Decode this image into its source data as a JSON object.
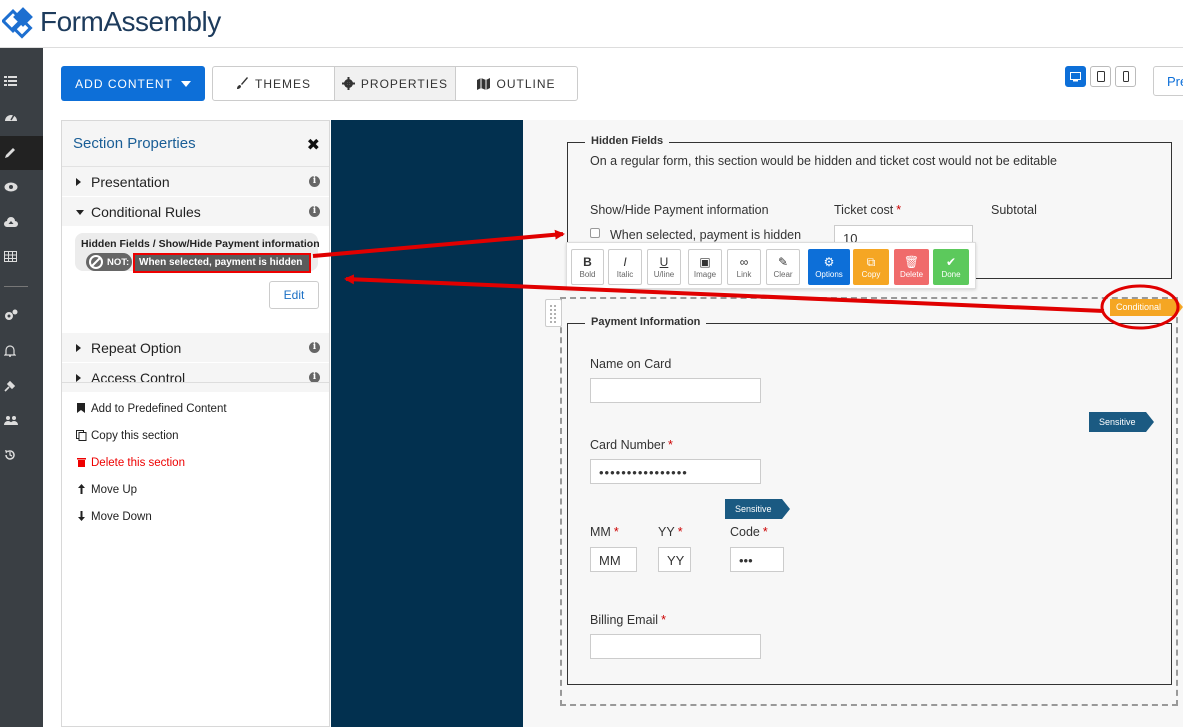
{
  "app": {
    "logo_text": "FormAssembly"
  },
  "toolbar": {
    "add_content_label": "ADD CONTENT",
    "tabs": [
      {
        "label": "THEMES",
        "icon": "brush-icon"
      },
      {
        "label": "PROPERTIES",
        "icon": "gear-icon"
      },
      {
        "label": "OUTLINE",
        "icon": "map-icon"
      }
    ],
    "preview_label": "Pre"
  },
  "panel": {
    "title": "Section Properties",
    "sections": [
      {
        "label": "Presentation",
        "expanded": false
      },
      {
        "label": "Conditional Rules",
        "expanded": true
      },
      {
        "label": "Repeat Option",
        "expanded": false
      },
      {
        "label": "Access Control",
        "expanded": false
      }
    ],
    "rule": {
      "title": "Hidden Fields / Show/Hide Payment information",
      "not_label": "NOT:",
      "condition": "When selected, payment is hidden",
      "edit_label": "Edit"
    },
    "actions": [
      {
        "label": "Add to Predefined Content",
        "icon": "bookmark-icon"
      },
      {
        "label": "Copy this section",
        "icon": "copy-icon"
      },
      {
        "label": "Delete this section",
        "icon": "trash-icon"
      },
      {
        "label": "Move Up",
        "icon": "arrow-up-icon"
      },
      {
        "label": "Move Down",
        "icon": "arrow-down-icon"
      }
    ]
  },
  "form": {
    "hidden_fields": {
      "legend": "Hidden Fields",
      "note": "On a regular form, this section would be hidden and ticket cost would not be editable",
      "show_hide_label": "Show/Hide Payment information",
      "checkbox_label": "When selected, payment is hidden",
      "ticket_cost_label": "Ticket cost",
      "ticket_cost_value": "10",
      "subtotal_label": "Subtotal",
      "required_mark": "*"
    },
    "rich_toolbar": [
      {
        "glyph": "B",
        "label": "Bold"
      },
      {
        "glyph": "I",
        "label": "Italic"
      },
      {
        "glyph": "U",
        "label": "U/line"
      },
      {
        "glyph": "▣",
        "label": "Image"
      },
      {
        "glyph": "∞",
        "label": "Link"
      },
      {
        "glyph": "✎",
        "label": "Clear"
      },
      {
        "glyph": "⚙",
        "label": "Options",
        "color": "#0d6fd8"
      },
      {
        "glyph": "⧉",
        "label": "Copy",
        "color": "#f5a623"
      },
      {
        "glyph": "🗑",
        "label": "Delete",
        "color": "#f06b6b"
      },
      {
        "glyph": "✔",
        "label": "Done",
        "color": "#5cc95c"
      }
    ],
    "payment": {
      "legend": "Payment Information",
      "conditional_badge": "Conditional",
      "sensitive_badge": "Sensitive",
      "name_label": "Name on Card",
      "card_label": "Card Number",
      "card_value": "••••••••••••••••",
      "mm_label": "MM",
      "yy_label": "YY",
      "code_label": "Code",
      "mm_value": "MM",
      "yy_value": "YY",
      "code_value": "•••",
      "email_label": "Billing Email",
      "required_mark": "*"
    }
  },
  "colors": {
    "primary": "#0d6fd8",
    "nav_bg": "#3a3f44",
    "dark_blue_bar": "#02304f",
    "annotation_red": "#e00000",
    "conditional": "#f5a623",
    "sensitive": "#1b5a82"
  }
}
